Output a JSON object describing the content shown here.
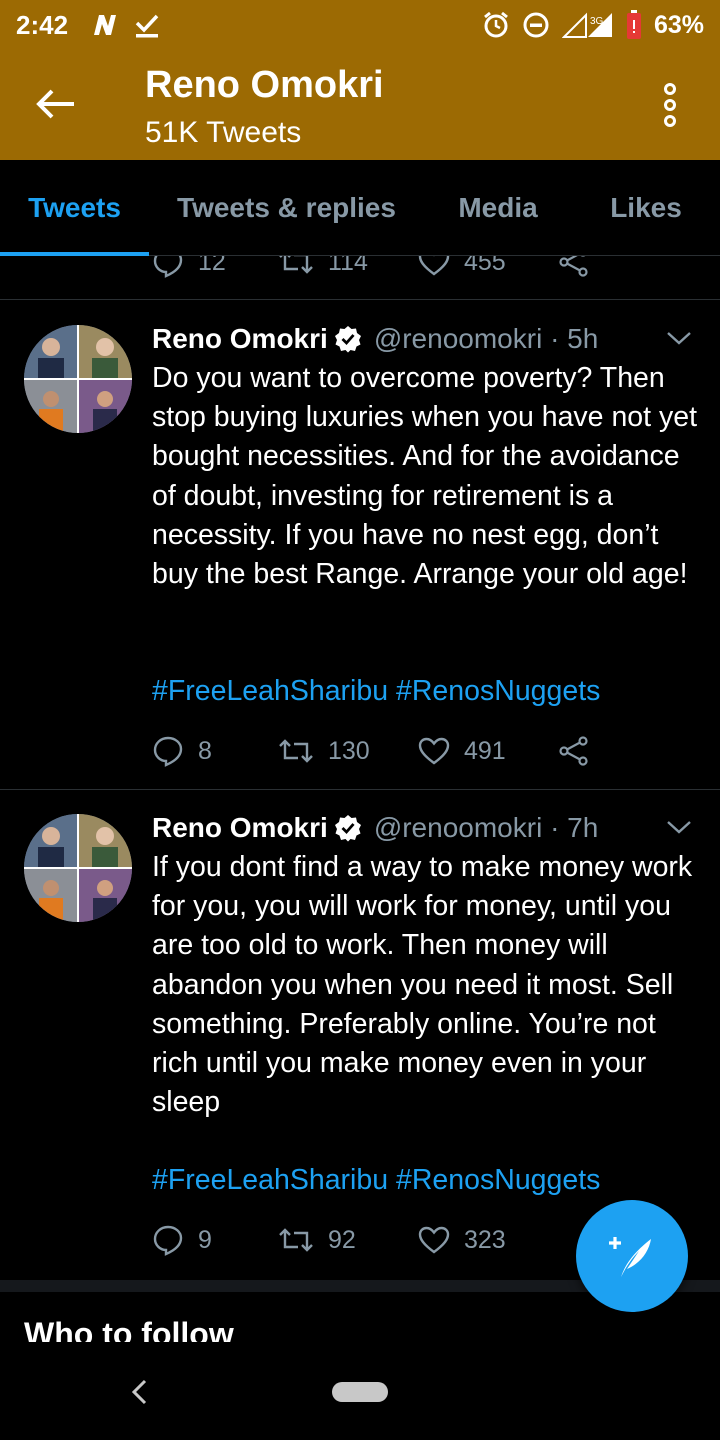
{
  "status_bar": {
    "time": "2:42",
    "battery": "63%",
    "network": "3G"
  },
  "header": {
    "title": "Reno Omokri",
    "subtitle": "51K Tweets"
  },
  "tabs": [
    {
      "label": "Tweets",
      "active": true
    },
    {
      "label": "Tweets & replies",
      "active": false
    },
    {
      "label": "Media",
      "active": false
    },
    {
      "label": "Likes",
      "active": false
    }
  ],
  "previous_tweet_actions": {
    "replies": "12",
    "retweets": "114",
    "likes": "455"
  },
  "tweets": [
    {
      "name": "Reno Omokri",
      "handle": "@renoomokri · 5h",
      "text": "Do you want to overcome poverty? Then stop buying luxuries when you have not yet bought necessities. And for the avoidance of doubt, investing for retirement is a necessity. If you have no nest egg, don’t buy the best Range. Arrange your old age!",
      "hashtags": "#FreeLeahSharibu #RenosNuggets",
      "replies": "8",
      "retweets": "130",
      "likes": "491"
    },
    {
      "name": "Reno Omokri",
      "handle": "@renoomokri · 7h",
      "text": "If you dont find a way to make money work for you, you will work for money, until you are too old to work. Then money will abandon you when you need it most. Sell something. Preferably online. You’re not rich until you make money even in your sleep",
      "hashtags": "#FreeLeahSharibu #RenosNuggets",
      "replies": "9",
      "retweets": "92",
      "likes": "323"
    }
  ],
  "who_to_follow": "Who to follow",
  "colors": {
    "header_bg": "#9c6a03",
    "accent": "#1da1f2",
    "muted": "#8899a6",
    "background": "#000000"
  }
}
